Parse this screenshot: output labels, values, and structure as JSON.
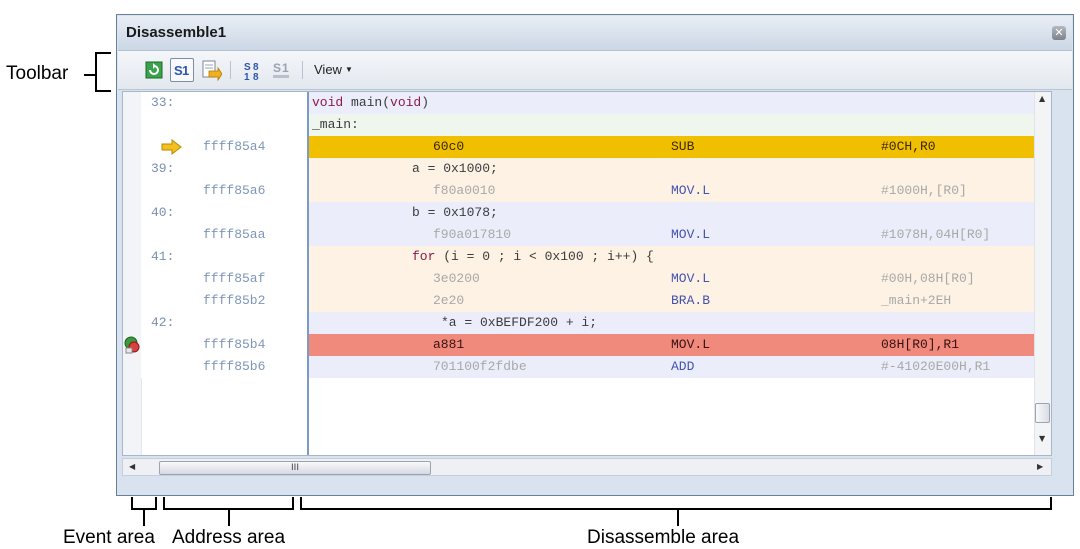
{
  "callouts": {
    "toolbar": "Toolbar",
    "event_area": "Event area",
    "address_area": "Address area",
    "disassemble_area": "Disassemble area"
  },
  "window": {
    "title": "Disassemble1",
    "close_glyph": "✕"
  },
  "toolbar": {
    "view_label": "View",
    "buttons": [
      "refresh-icon",
      "mixed-display-icon",
      "source-jump-icon",
      "symbol-display-icon",
      "offset-display-icon"
    ]
  },
  "rows": [
    {
      "kind": "src",
      "num": "33:",
      "text_kw": "void",
      "text_a": " main(",
      "text_kw2": "void",
      ")": ")",
      "bg": "lav"
    },
    {
      "kind": "label",
      "text": "_main:",
      "bg": "green"
    },
    {
      "kind": "asm",
      "addr": "ffff85a4",
      "code": "60c0",
      "mn": "SUB",
      "op": "#0CH,R0",
      "bg": "yel",
      "current": true
    },
    {
      "kind": "src",
      "num": "39:",
      "text": "a = 0x1000;",
      "bg": "peach"
    },
    {
      "kind": "asm",
      "addr": "ffff85a6",
      "code": "f80a0010",
      "mn": "MOV.L",
      "op": "#1000H,[R0]",
      "bg": "peach"
    },
    {
      "kind": "src",
      "num": "40:",
      "text": "b = 0x1078;",
      "bg": "lav"
    },
    {
      "kind": "asm",
      "addr": "ffff85aa",
      "code": "f90a017810",
      "mn": "MOV.L",
      "op": "#1078H,04H[R0]",
      "bg": "lav"
    },
    {
      "kind": "src",
      "num": "41:",
      "text_kw": "for",
      "text_a": " (i = 0 ; i < 0x100 ; i++) {",
      "bg": "peach"
    },
    {
      "kind": "asm",
      "addr": "ffff85af",
      "code": "3e0200",
      "mn": "MOV.L",
      "op": "#00H,08H[R0]",
      "bg": "peach"
    },
    {
      "kind": "asm",
      "addr": "ffff85b2",
      "code": "2e20",
      "mn": "BRA.B",
      "op": "_main+2EH",
      "bg": "peach"
    },
    {
      "kind": "src",
      "num": "42:",
      "text": "*a = 0xBEFDF200 + i;",
      "bg": "lav"
    },
    {
      "kind": "asm",
      "addr": "ffff85b4",
      "code": "a881",
      "mn": "MOV.L",
      "op": "08H[R0],R1",
      "bg": "red",
      "breakpoint": true
    },
    {
      "kind": "asm",
      "addr": "ffff85b6",
      "code": "701100f2fdbe",
      "mn": "ADD",
      "op": "#-41020E00H,R1",
      "bg": "lav"
    }
  ],
  "hscroll_grip": "III",
  "colors": {
    "current_line": "#f0c000",
    "breakpoint_line": "#f08a7c",
    "separator": "#7d99c8"
  }
}
